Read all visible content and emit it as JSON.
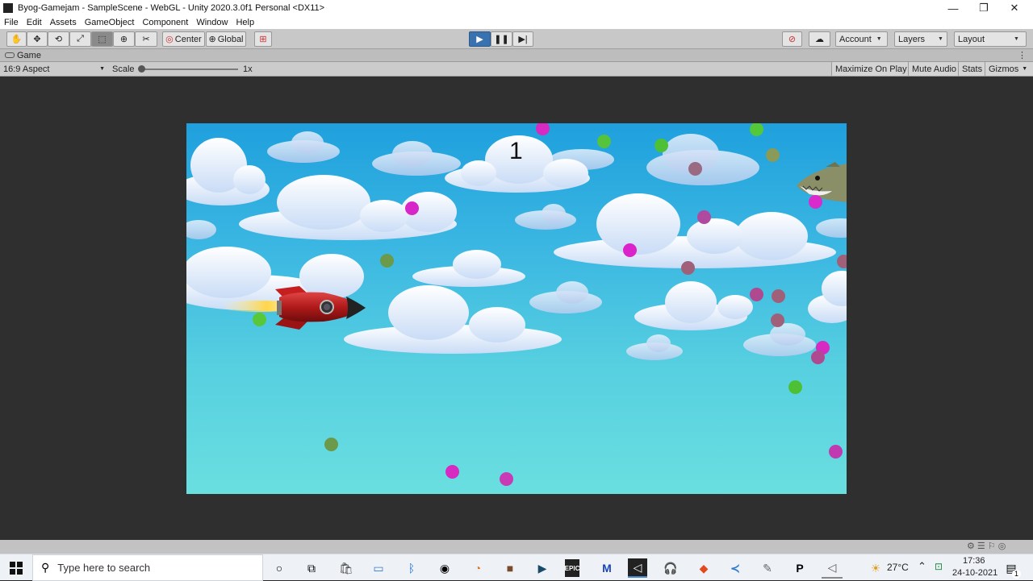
{
  "window": {
    "title": "Byog-Gamejam - SampleScene - WebGL - Unity 2020.3.0f1 Personal <DX11>",
    "controls": [
      "—",
      "❐",
      "✕"
    ]
  },
  "menu": [
    "File",
    "Edit",
    "Assets",
    "GameObject",
    "Component",
    "Window",
    "Help"
  ],
  "toolbar": {
    "pivot_label": "Center",
    "space_label": "Global",
    "account_label": "Account",
    "layers_label": "Layers",
    "layout_label": "Layout"
  },
  "game_tab": {
    "label": "Game"
  },
  "game_bar": {
    "aspect": "16:9 Aspect",
    "scale_label": "Scale",
    "scale_value": "1x",
    "maximize_label": "Maximize On Play",
    "mute_label": "Mute Audio",
    "stats_label": "Stats",
    "gizmos_label": "Gizmos"
  },
  "game": {
    "score": "1",
    "colors": {
      "magenta": "#e020c8",
      "green": "#58c83a",
      "olive": "#6a9a4a",
      "mauve": "#a0607a"
    }
  },
  "taskbar": {
    "search_placeholder": "Type here to search",
    "weather_temp": "27°C",
    "time": "17:36",
    "date": "24-10-2021",
    "notification_count": "1"
  }
}
